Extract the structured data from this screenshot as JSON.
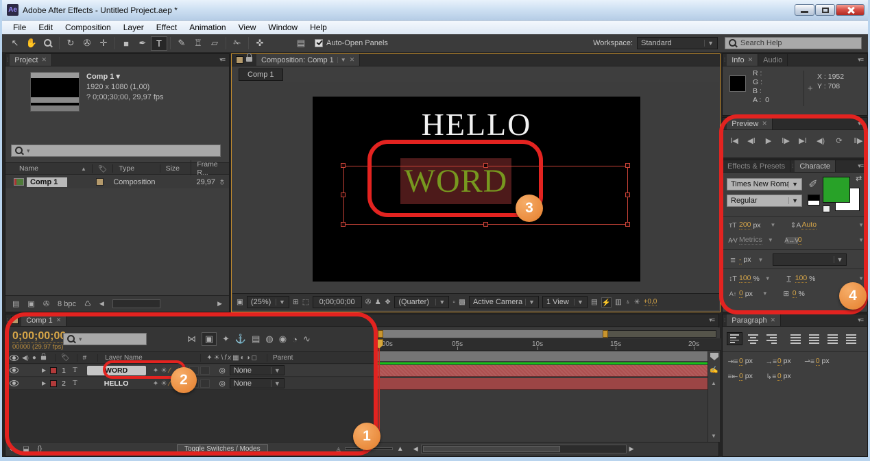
{
  "window": {
    "title": "Adobe After Effects - Untitled Project.aep *",
    "app_icon": "Ae"
  },
  "menu": {
    "items": [
      "File",
      "Edit",
      "Composition",
      "Layer",
      "Effect",
      "Animation",
      "View",
      "Window",
      "Help"
    ]
  },
  "toolbar": {
    "auto_open_label": "Auto-Open Panels",
    "workspace_label": "Workspace:",
    "workspace_value": "Standard",
    "search_placeholder": "Search Help"
  },
  "project": {
    "tab": "Project",
    "comp_name": "Comp 1",
    "dimensions": "1920 x 1080 (1,00)",
    "duration": "? 0;00;30;00, 29,97 fps",
    "columns": {
      "name": "Name",
      "type": "Type",
      "size": "Size",
      "rate": "Frame R..."
    },
    "row": {
      "name": "Comp 1",
      "type": "Composition",
      "rate": "29,97"
    },
    "bit_depth": "8 bpc"
  },
  "comp": {
    "tab": "Composition: Comp 1",
    "subtab": "Comp 1",
    "hello_text": "HELLO",
    "word_text": "WORD",
    "zoom": "(25%)",
    "timecode": "0;00;00;00",
    "resolution": "(Quarter)",
    "camera": "Active Camera",
    "view": "1 View",
    "exposure": "+0,0"
  },
  "info": {
    "tab": "Info",
    "audio_tab": "Audio",
    "r": "R :",
    "g": "G :",
    "b": "B :",
    "a": "A :",
    "a_val": "0",
    "x": "X : 1952",
    "y": "Y : 708"
  },
  "preview": {
    "tab": "Preview"
  },
  "character": {
    "effects_tab": "Effects & Presets",
    "tab": "Characte",
    "font": "Times New Roman",
    "style": "Regular",
    "size_val": "200",
    "size_unit": "px",
    "leading_val": "Auto",
    "kerning_val": "Metrics",
    "tracking_val": "0",
    "stroke_val": "-",
    "stroke_unit": "px",
    "vscale_val": "100",
    "vscale_unit": "%",
    "hscale_val": "100",
    "hscale_unit": "%",
    "baseline_val": "0",
    "baseline_unit": "px",
    "tsume_val": "0",
    "tsume_unit": "%",
    "fill_color": "#28a228"
  },
  "paragraph": {
    "tab": "Paragraph",
    "indent_left_val": "0",
    "indent_left_unit": "px",
    "space_before_val": "0",
    "space_before_unit": "px",
    "first_line_val": "0",
    "first_line_unit": "px",
    "indent_right_val": "0",
    "indent_right_unit": "px",
    "space_after_val": "0",
    "space_after_unit": "px"
  },
  "timeline": {
    "tab": "Comp 1",
    "timecode": "0;00;00;00",
    "frames": "00000 (29.97 fps)",
    "columns": {
      "hash": "#",
      "layer_name": "Layer Name",
      "parent": "Parent"
    },
    "layers": [
      {
        "num": "1",
        "name": "WORD",
        "parent": "None"
      },
      {
        "num": "2",
        "name": "HELLO",
        "parent": "None"
      }
    ],
    "toggle_button": "Toggle Switches / Modes",
    "ruler": [
      ":00s",
      "05s",
      "10s",
      "15s",
      "20s"
    ]
  },
  "annotations": {
    "n1": "1",
    "n2": "2",
    "n3": "3",
    "n4": "4",
    "accent_red": "#e32320",
    "badge_orange": "#ea8c3e"
  },
  "colors": {
    "timecode_orange": "#d7a648",
    "layer_bar_red": "#ad5050",
    "render_green": "#17c017",
    "selection_red": "#cc4438",
    "word_highlight": "#4d1a1a"
  }
}
